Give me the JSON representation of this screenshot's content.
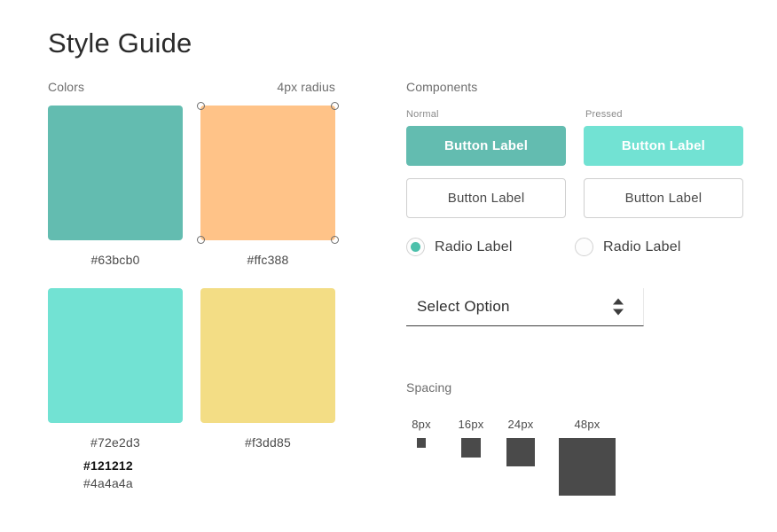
{
  "page": {
    "title": "Style Guide",
    "background": "#ffffff"
  },
  "colors": {
    "heading": "Colors",
    "radius_note": "4px radius",
    "swatches": [
      {
        "hex": "#63bcb0",
        "label": "#63bcb0",
        "handles": false
      },
      {
        "hex": "#ffc388",
        "label": "#ffc388",
        "handles": true
      },
      {
        "hex": "#72e2d3",
        "label": "#72e2d3",
        "handles": false
      },
      {
        "hex": "#f3dd85",
        "label": "#f3dd85",
        "handles": false
      }
    ],
    "text_colors": [
      {
        "label": "#121212",
        "hex": "#121212",
        "weight": "bold"
      },
      {
        "label": "#4a4a4a",
        "hex": "#4a4a4a",
        "weight": "regular"
      }
    ]
  },
  "components": {
    "heading": "Components",
    "states": {
      "normal_label": "Normal",
      "pressed_label": "Pressed"
    },
    "buttons": {
      "primary_normal": {
        "label": "Button Label",
        "bg": "#63bcb0",
        "text": "#ffffff"
      },
      "primary_pressed": {
        "label": "Button Label",
        "bg": "#72e2d3",
        "text": "#ffffff"
      },
      "outline_normal": {
        "label": "Button Label",
        "bg": "#ffffff",
        "text": "#4a4a4a",
        "border": "#cfcfcf"
      },
      "outline_pressed": {
        "label": "Button Label",
        "bg": "#ffffff",
        "text": "#4a4a4a",
        "border": "#cfcfcf"
      }
    },
    "radios": {
      "selected": {
        "label": "Radio Label",
        "checked": "true",
        "dot_color": "#4cc0ab"
      },
      "unselected": {
        "label": "Radio Label",
        "checked": "false"
      }
    },
    "select": {
      "value": "Select Option",
      "placeholder": "Select Option",
      "stepper_up": "increment",
      "stepper_down": "decrement"
    }
  },
  "spacing": {
    "heading": "Spacing",
    "color": "#4a4a4a",
    "items": [
      {
        "label": "8px",
        "size": 8
      },
      {
        "label": "16px",
        "size": 16
      },
      {
        "label": "24px",
        "size": 24
      },
      {
        "label": "48px",
        "size": 48
      }
    ]
  }
}
